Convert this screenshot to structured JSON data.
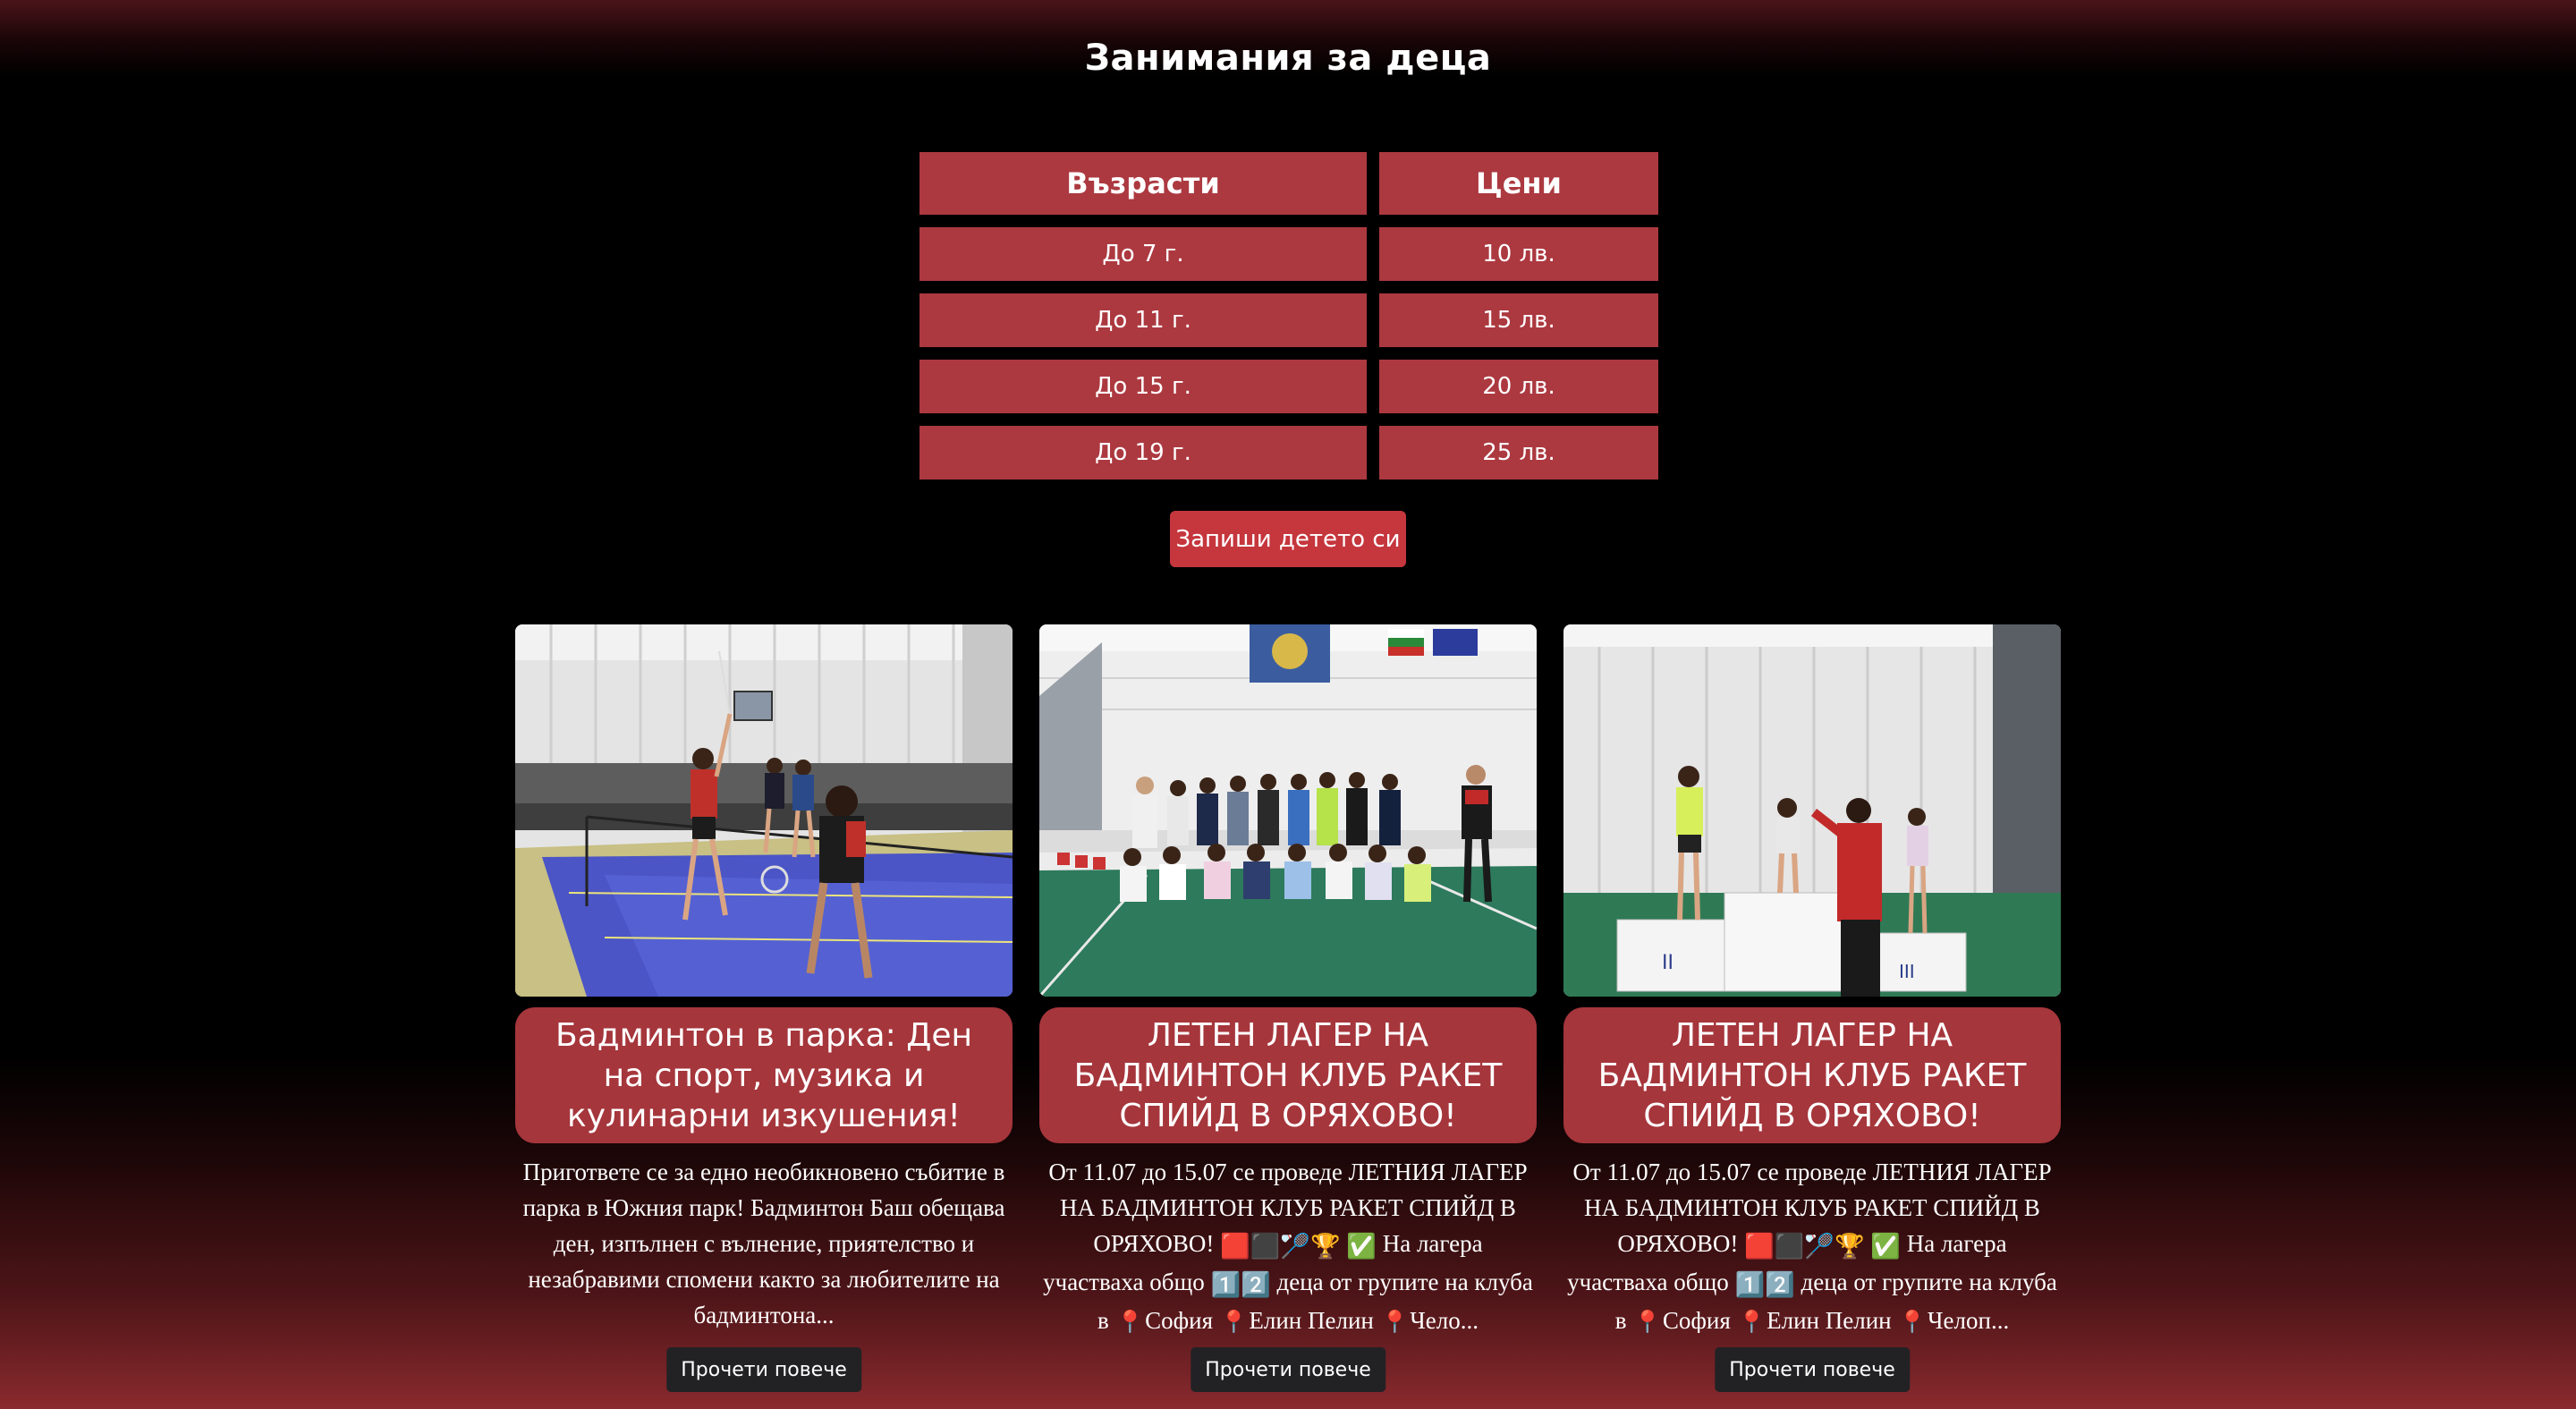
{
  "page": {
    "title": "Занимания за деца"
  },
  "price_table": {
    "headers": [
      "Възрасти",
      "Цени"
    ],
    "rows": [
      {
        "age": "До 7 г.",
        "price": "10 лв."
      },
      {
        "age": "До 11 г.",
        "price": "15 лв."
      },
      {
        "age": "До 15 г.",
        "price": "20 лв."
      },
      {
        "age": "До 19 г.",
        "price": "25 лв."
      }
    ]
  },
  "enroll_button": "Запиши детето си",
  "cards": [
    {
      "title": "Бадминтон в парка: Ден на спорт, музика и кулинарни изкушения!",
      "text": "Пригответе се за едно необикновено събитие в парка в Южния парк! Бадминтон Баш обещава ден, изпълнен с вълнение, приятелство и незабравими спомени както за любителите на бадминтона...",
      "button": "Прочети повече"
    },
    {
      "title": "ЛЕТЕН ЛАГЕР НА БАДМИНТОН КЛУБ РАКЕТ СПИЙД В ОРЯХОВО!",
      "text_before": "От 11.07 до 15.07 се проведе ЛЕТНИЯ ЛАГЕР НА БАДМИНТОН КЛУБ РАКЕТ СПИЙД В ОРЯХОВО!",
      "text_mid": "На лагера участваха общо",
      "text_after": "деца от групите на клуба в",
      "places": [
        "София",
        "Елин Пелин",
        "Чело..."
      ],
      "button": "Прочети повече"
    },
    {
      "title": "ЛЕТЕН ЛАГЕР НА БАДМИНТОН КЛУБ РАКЕТ СПИЙД В ОРЯХОВО!",
      "text_before": "От 11.07 до 15.07 се проведе ЛЕТНИЯ ЛАГЕР НА БАДМИНТОН КЛУБ РАКЕТ СПИЙД В ОРЯХОВО!",
      "text_mid": "На лагера участваха общо",
      "text_after": "деца от групите на клуба в",
      "places": [
        "София",
        "Елин Пелин",
        "Челоп..."
      ],
      "button": "Прочети повече"
    }
  ],
  "colors": {
    "table_cell": "#ac3940",
    "enroll_button": "#c5363d",
    "card_title": "#a5363c",
    "read_more_button": "#222225"
  }
}
